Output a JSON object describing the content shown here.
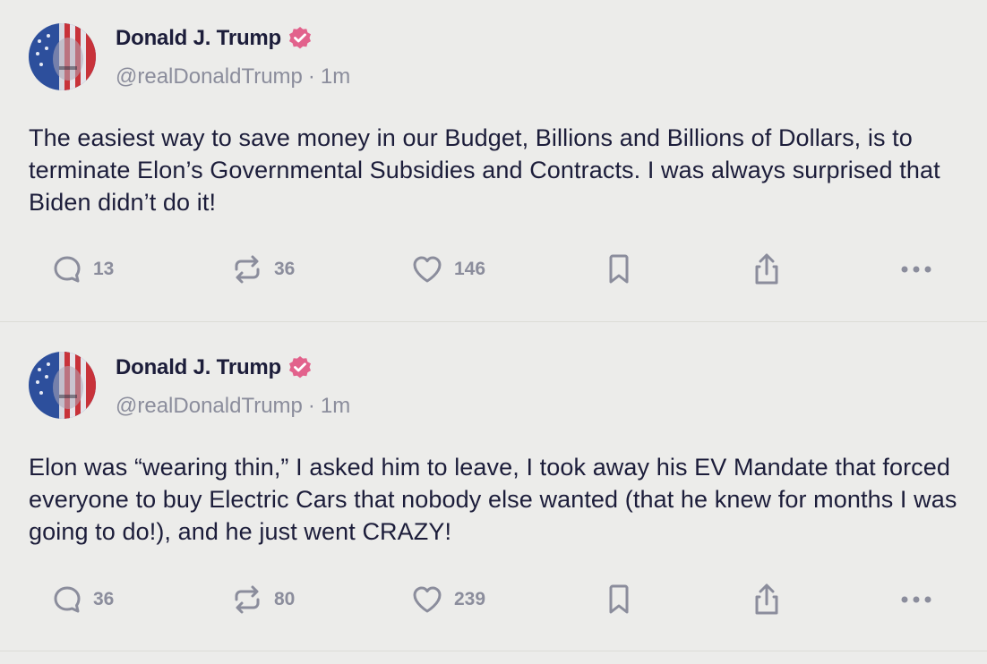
{
  "posts": [
    {
      "display_name": "Donald J. Trump",
      "handle": "@realDonaldTrump",
      "separator": "·",
      "time": "1m",
      "text": "The easiest way to save money in our Budget, Billions and Billions of Dollars, is to terminate Elon’s Governmental Subsidies and Contracts. I was always surprised that Biden didn’t do it!",
      "replies": "13",
      "retruths": "36",
      "likes": "146"
    },
    {
      "display_name": "Donald J. Trump",
      "handle": "@realDonaldTrump",
      "separator": "·",
      "time": "1m",
      "text": "Elon was “wearing thin,” I asked him to leave, I took away his EV Mandate that forced everyone to buy Electric Cars that nobody else wanted (that he knew for months I was going to do!), and he just went CRAZY!",
      "replies": "36",
      "retruths": "80",
      "likes": "239"
    }
  ],
  "icons": {
    "reply": "speech-bubble-icon",
    "retruth": "repost-arrows-icon",
    "like": "heart-icon",
    "bookmark": "bookmark-icon",
    "share": "share-icon",
    "more": "more-dots-icon",
    "verified": "verified-badge-icon"
  },
  "colors": {
    "background": "#ececea",
    "text": "#1c1d3a",
    "muted": "#8b8d9c",
    "verified": "#e2628c"
  }
}
